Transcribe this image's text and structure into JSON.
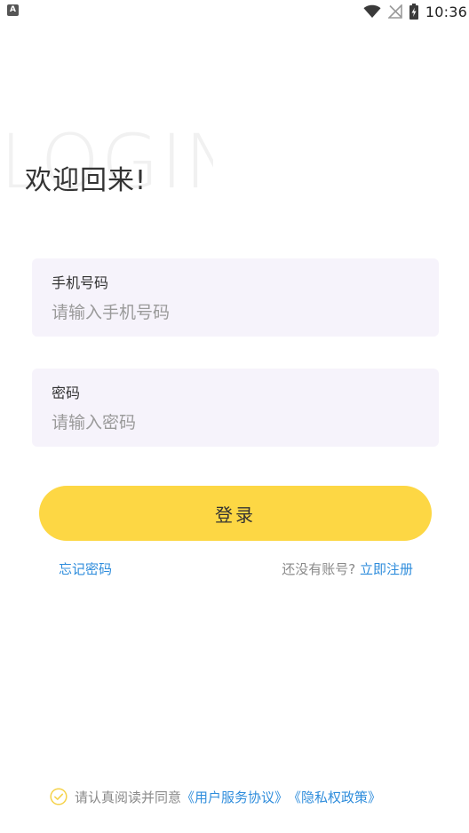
{
  "status_bar": {
    "app_icon_letter": "A",
    "time": "10:36"
  },
  "background": {
    "watermark": "LOGIN"
  },
  "header": {
    "title": "欢迎回来!"
  },
  "form": {
    "phone": {
      "label": "手机号码",
      "placeholder": "请输入手机号码",
      "value": ""
    },
    "password": {
      "label": "密码",
      "placeholder": "请输入密码",
      "value": ""
    },
    "login_label": "登录"
  },
  "links": {
    "forgot_password": "忘记密码",
    "no_account_prompt": "还没有账号?",
    "register": "立即注册"
  },
  "agreement": {
    "prefix": "请认真阅读并同意",
    "service_agreement": "《用户服务协议》",
    "privacy_policy": "《隐私权政策》",
    "checked": false
  },
  "colors": {
    "accent_yellow": "#fdd744",
    "link_blue": "#2f8ddc",
    "field_bg": "#f6f3fb",
    "check_yellow": "#f5d24a"
  },
  "icons": {
    "status": [
      "wifi-icon",
      "no-signal-icon",
      "battery-charging-icon"
    ],
    "agreement": "check-circle-icon"
  }
}
